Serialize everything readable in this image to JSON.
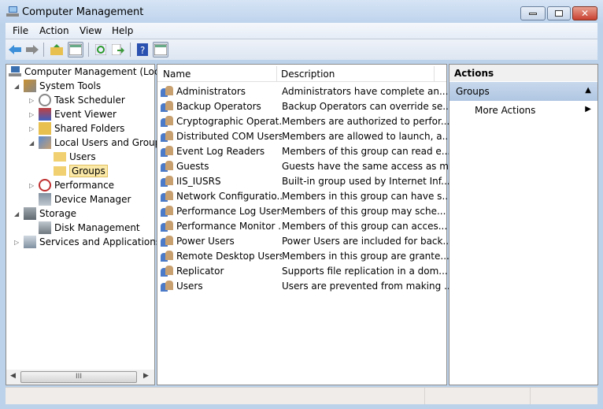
{
  "window": {
    "title": "Computer Management"
  },
  "menu": [
    "File",
    "Action",
    "View",
    "Help"
  ],
  "toolbar": [
    "back-icon",
    "forward-icon",
    "up-folder-icon",
    "show-hide-console-tree-icon",
    "refresh-icon",
    "export-list-icon",
    "help-icon",
    "show-hide-action-pane-icon"
  ],
  "tree": {
    "root": "Computer Management (Local",
    "system_tools": "System Tools",
    "task_scheduler": "Task Scheduler",
    "event_viewer": "Event Viewer",
    "shared_folders": "Shared Folders",
    "local_users_groups": "Local Users and Groups",
    "users": "Users",
    "groups": "Groups",
    "performance": "Performance",
    "device_manager": "Device Manager",
    "storage": "Storage",
    "disk_management": "Disk Management",
    "services_apps": "Services and Applications",
    "scroll_thumb": "III"
  },
  "list": {
    "columns": [
      "Name",
      "Description"
    ],
    "rows": [
      {
        "name": "Administrators",
        "desc": "Administrators have complete an..."
      },
      {
        "name": "Backup Operators",
        "desc": "Backup Operators can override se..."
      },
      {
        "name": "Cryptographic Operat...",
        "desc": "Members are authorized to perfor..."
      },
      {
        "name": "Distributed COM Users",
        "desc": "Members are allowed to launch, a..."
      },
      {
        "name": "Event Log Readers",
        "desc": "Members of this group can read e..."
      },
      {
        "name": "Guests",
        "desc": "Guests have the same access as m..."
      },
      {
        "name": "IIS_IUSRS",
        "desc": "Built-in group used by Internet Inf..."
      },
      {
        "name": "Network Configuratio...",
        "desc": "Members in this group can have s..."
      },
      {
        "name": "Performance Log Users",
        "desc": "Members of this group may sche..."
      },
      {
        "name": "Performance Monitor ...",
        "desc": "Members of this group can acces..."
      },
      {
        "name": "Power Users",
        "desc": "Power Users are included for back..."
      },
      {
        "name": "Remote Desktop Users",
        "desc": "Members in this group are grante..."
      },
      {
        "name": "Replicator",
        "desc": "Supports file replication in a dom..."
      },
      {
        "name": "Users",
        "desc": "Users are prevented from making ..."
      }
    ]
  },
  "actions": {
    "title": "Actions",
    "section": "Groups",
    "more": "More Actions"
  }
}
